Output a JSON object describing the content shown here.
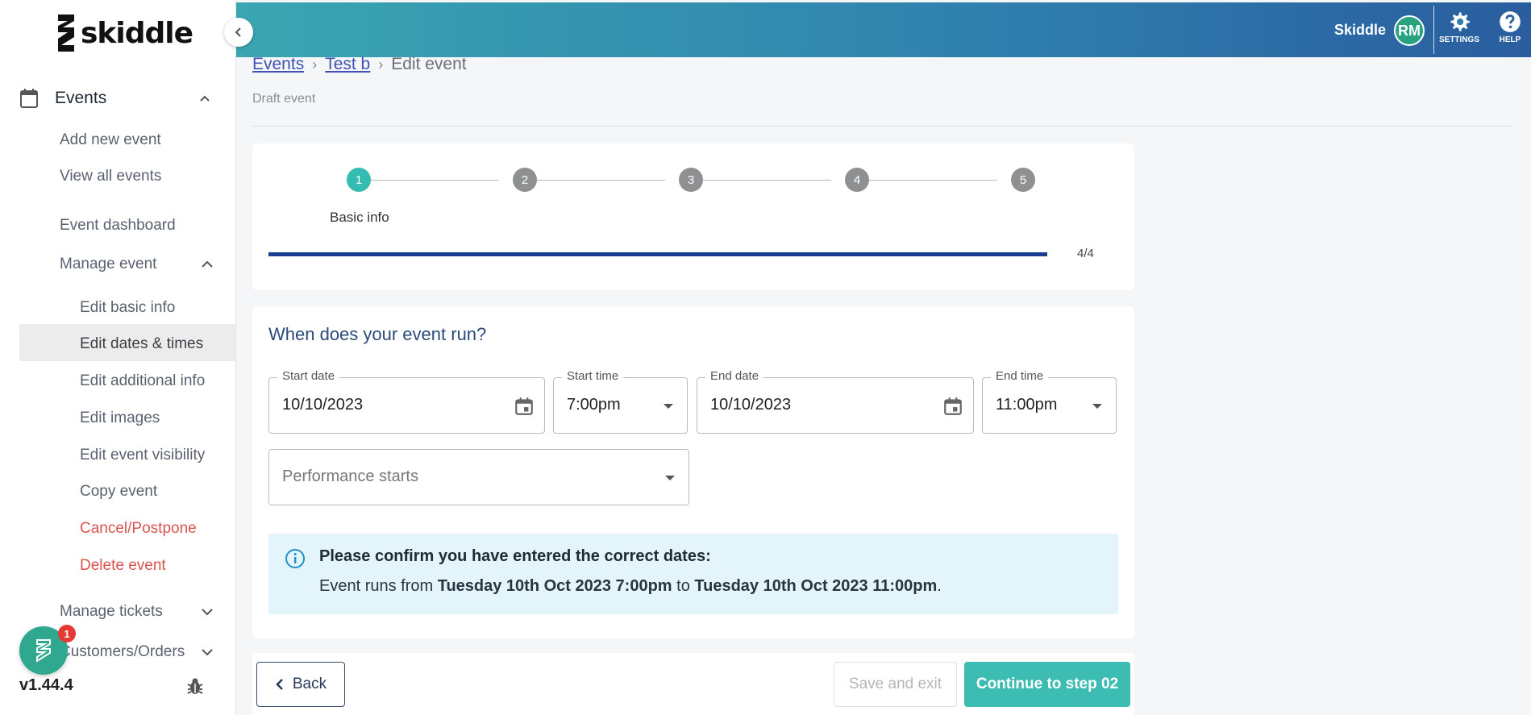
{
  "brand": {
    "logo_text": "skiddle"
  },
  "topbar": {
    "user_name": "Skiddle",
    "avatar_initials": "RM",
    "settings_label": "SETTINGS",
    "help_label": "HELP"
  },
  "sidebar": {
    "events_label": "Events",
    "items": {
      "add_new_event": "Add new event",
      "view_all_events": "View all events",
      "event_dashboard": "Event dashboard",
      "manage_event": "Manage event",
      "edit_basic_info": "Edit basic info",
      "edit_dates_times": "Edit dates & times",
      "edit_additional_info": "Edit additional info",
      "edit_images": "Edit images",
      "edit_event_visibility": "Edit event visibility",
      "copy_event": "Copy event",
      "cancel_postpone": "Cancel/Postpone",
      "delete_event": "Delete event",
      "manage_tickets": "Manage tickets",
      "customers_orders": "Customers/Orders"
    },
    "chat_badge_count": "1",
    "version": "v1.44.4"
  },
  "breadcrumb": {
    "events": "Events",
    "event_name": "Test b",
    "current": "Edit event",
    "separator": "›"
  },
  "draft_label": "Draft event",
  "stepper": {
    "steps": [
      "1",
      "2",
      "3",
      "4",
      "5"
    ],
    "active_step_label": "Basic info",
    "progress_text": "4/4",
    "progress_fraction": 1.0
  },
  "form": {
    "title": "When does your event run?",
    "start_date": {
      "label": "Start date",
      "value": "10/10/2023"
    },
    "start_time": {
      "label": "Start time",
      "value": "7:00pm"
    },
    "end_date": {
      "label": "End date",
      "value": "10/10/2023"
    },
    "end_time": {
      "label": "End time",
      "value": "11:00pm"
    },
    "performance_starts": {
      "placeholder": "Performance starts"
    }
  },
  "info": {
    "title": "Please confirm you have entered the correct dates:",
    "prefix": "Event runs from ",
    "start": "Tuesday 10th Oct 2023 7:00pm",
    "middle": " to ",
    "end": "Tuesday 10th Oct 2023 11:00pm",
    "suffix": "."
  },
  "buttons": {
    "back": "Back",
    "save_exit": "Save and exit",
    "continue": "Continue to step 02"
  },
  "colors": {
    "accent_teal": "#3cbcb3",
    "progress_blue": "#1a3d8f",
    "danger_red": "#d9534f"
  }
}
